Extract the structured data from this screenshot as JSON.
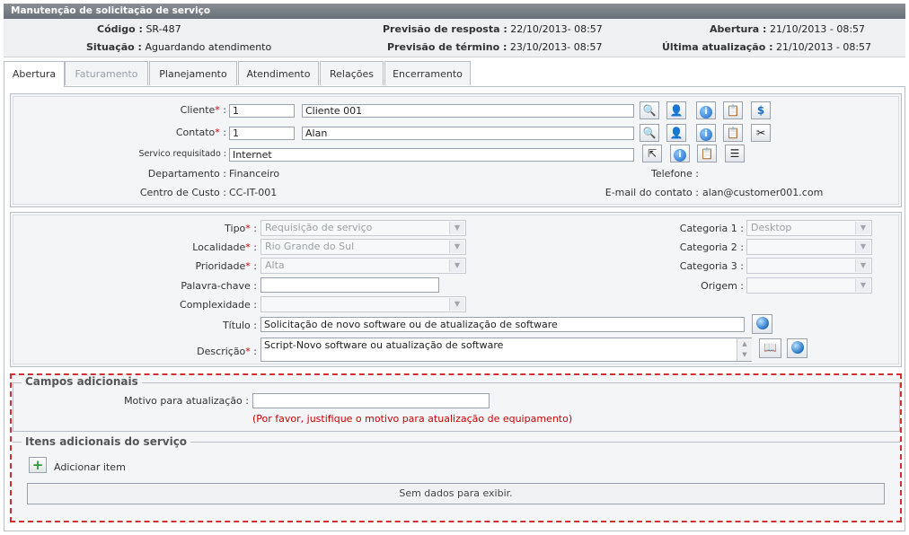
{
  "window": {
    "title": "Manutenção de solicitação de serviço"
  },
  "summary": {
    "codigo_label": "Código :",
    "codigo": "SR-487",
    "situacao_label": "Situação :",
    "situacao": "Aguardando atendimento",
    "prev_resp_label": "Previsão de resposta :",
    "prev_resp": "22/10/2013- 08:57",
    "prev_term_label": "Previsão de término :",
    "prev_term": "23/10/2013- 08:57",
    "abertura_label": "Abertura :",
    "abertura": "21/10/2013 - 08:57",
    "ultima_label": "Última atualização :",
    "ultima": "21/10/2013 - 08:57"
  },
  "tabs": [
    {
      "label": "Abertura",
      "active": true
    },
    {
      "label": "Faturamento",
      "disabled": true
    },
    {
      "label": "Planejamento"
    },
    {
      "label": "Atendimento"
    },
    {
      "label": "Relações"
    },
    {
      "label": "Encerramento"
    }
  ],
  "customer": {
    "cliente_label": "Cliente",
    "cliente_code": "1",
    "cliente_name": "Cliente 001",
    "contato_label": "Contato",
    "contato_code": "1",
    "contato_name": "Alan",
    "servico_label": "Servico requisitado",
    "servico": "Internet",
    "departamento_label": "Departamento :",
    "departamento": "Financeiro",
    "telefone_label": "Telefone :",
    "telefone": "",
    "centro_label": "Centro de Custo :",
    "centro": "CC-IT-001",
    "email_label": "E-mail do contato :",
    "email": "alan@customer001.com"
  },
  "details": {
    "tipo_label": "Tipo",
    "tipo": "Requisição de serviço",
    "localidade_label": "Localidade",
    "localidade": "Rio Grande do Sul",
    "prioridade_label": "Prioridade",
    "prioridade": "Alta",
    "palavra_label": "Palavra-chave :",
    "palavra": "",
    "complexidade_label": "Complexidade :",
    "complexidade": "",
    "titulo_label": "Título :",
    "titulo": "Solicitação de novo software ou de atualização de software",
    "descricao_label": "Descrição",
    "descricao": "Script-Novo software ou atualização de software",
    "cat1_label": "Categoria 1 :",
    "cat1": "Desktop",
    "cat2_label": "Categoria 2 :",
    "cat2": "",
    "cat3_label": "Categoria 3 :",
    "cat3": "",
    "origem_label": "Origem :",
    "origem": ""
  },
  "extra": {
    "legend": "Campos adicionais",
    "motivo_label": "Motivo para atualização :",
    "motivo": "",
    "hint": "(Por favor, justifique o motivo para atualização de equipamento)"
  },
  "items": {
    "legend": "Itens adicionais do serviço",
    "add_label": "Adicionar item",
    "empty": "Sem dados para exibir."
  }
}
